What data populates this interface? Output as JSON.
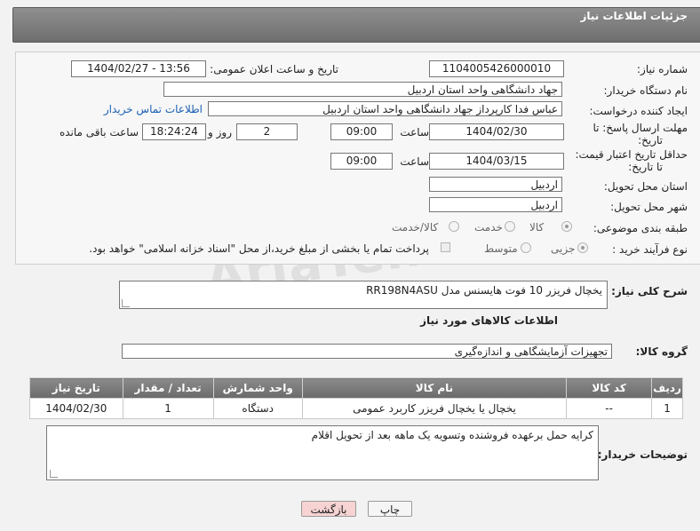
{
  "header": {
    "title": "جزئیات اطلاعات نیاز"
  },
  "form": {
    "need_number_label": "شماره نیاز:",
    "need_number": "1104005426000010",
    "announce_label": "تاریخ و ساعت اعلان عمومی:",
    "announce_value": "1404/02/27 - 13:56",
    "buyer_org_label": "نام دستگاه خریدار:",
    "buyer_org": "جهاد دانشگاهی واحد استان اردبیل",
    "creator_label": "ایجاد کننده درخواست:",
    "creator": "عباس فدا کارپرداز جهاد دانشگاهی واحد استان اردبیل",
    "contact_link": "اطلاعات تماس خریدار",
    "deadline_label_1": "مهلت ارسال پاسخ: تا",
    "deadline_label_2": "تاریخ:",
    "deadline_date": "1404/02/30",
    "time_label": "ساعت",
    "deadline_time": "09:00",
    "days_value": "2",
    "days_label": "روز و",
    "remaining_time": "18:24:24",
    "remaining_label": "ساعت باقی مانده",
    "validity_label_1": "حداقل تاریخ اعتبار قیمت:",
    "validity_label_2": "تا تاریخ:",
    "validity_date": "1404/03/15",
    "validity_time_label": "ساعت",
    "validity_time": "09:00",
    "province_label": "استان محل تحویل:",
    "province": "اردبیل",
    "city_label": "شهر محل تحویل:",
    "city": "اردبیل",
    "category_label": "طبقه بندی موضوعی:",
    "category_options": [
      "کالا",
      "خدمت",
      "کالا/خدمت"
    ],
    "category_selected": "کالا",
    "process_label": "نوع فرآیند خرید :",
    "process_options": [
      "جزیی",
      "متوسط"
    ],
    "process_selected": "جزیی",
    "payment_note": "پرداخت تمام یا بخشی از مبلغ خرید،از محل \"اسناد خزانه اسلامی\" خواهد بود."
  },
  "description": {
    "label": "شرح کلی نیاز:",
    "value": "یخچال فریزر 10 فوت هایسنس مدل RR198N4ASU"
  },
  "goods_info": {
    "title": "اطلاعات کالاهای مورد نیاز",
    "group_label": "گروه کالا:",
    "group_value": "تجهیزات آزمایشگاهی و اندازه‌گیری"
  },
  "table": {
    "columns": [
      "ردیف",
      "کد کالا",
      "نام کالا",
      "واحد شمارش",
      "تعداد / مقدار",
      "تاریخ نیاز"
    ],
    "rows": [
      [
        "1",
        "--",
        "یخچال یا یخچال فریزر کاربرد عمومی",
        "دستگاه",
        "1",
        "1404/02/30"
      ]
    ]
  },
  "buyer_notes": {
    "label": "توضیحات خریدار:",
    "value": "کرایه حمل برعهده فروشنده وتسویه یک ماهه بعد از تحویل اقلام"
  },
  "buttons": {
    "print": "چاپ",
    "back": "بازگشت"
  },
  "colors": {
    "header": "#7a7a7a",
    "link": "#1a5fb4",
    "back_button": "#f7d3d3"
  }
}
